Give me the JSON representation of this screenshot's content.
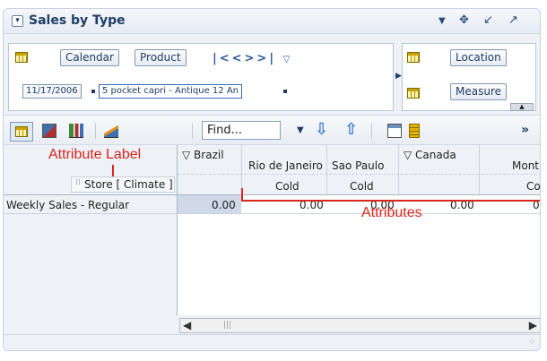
{
  "header": {
    "title": "Sales by Type"
  },
  "page_edge": {
    "tabs": [
      "Calendar",
      "Product"
    ],
    "values": [
      "11/17/2006",
      "5 pocket capri - Antique 12 An"
    ],
    "right_tabs": [
      "Location",
      "Measure"
    ]
  },
  "toolbar": {
    "find_placeholder": "Find..."
  },
  "table": {
    "row_label": "Weekly Sales - Regular",
    "store_label": "Store [ Climate ]",
    "columns": [
      {
        "label": "▽ Brazil",
        "attr": ""
      },
      {
        "label": "Rio de Janeiro",
        "attr": "Cold"
      },
      {
        "label": "Sao Paulo",
        "attr": "Cold"
      },
      {
        "label": "▽ Canada",
        "attr": ""
      },
      {
        "label": "Mont",
        "attr": "Co"
      }
    ],
    "values": [
      "0.00",
      "0.00",
      "0.00",
      "0.00",
      "0"
    ]
  },
  "annotations": {
    "attribute_label": "Attribute Label",
    "attributes": "Attributes"
  },
  "colors": {
    "accent": "#1f3d66",
    "annotation": "#d9261c"
  }
}
